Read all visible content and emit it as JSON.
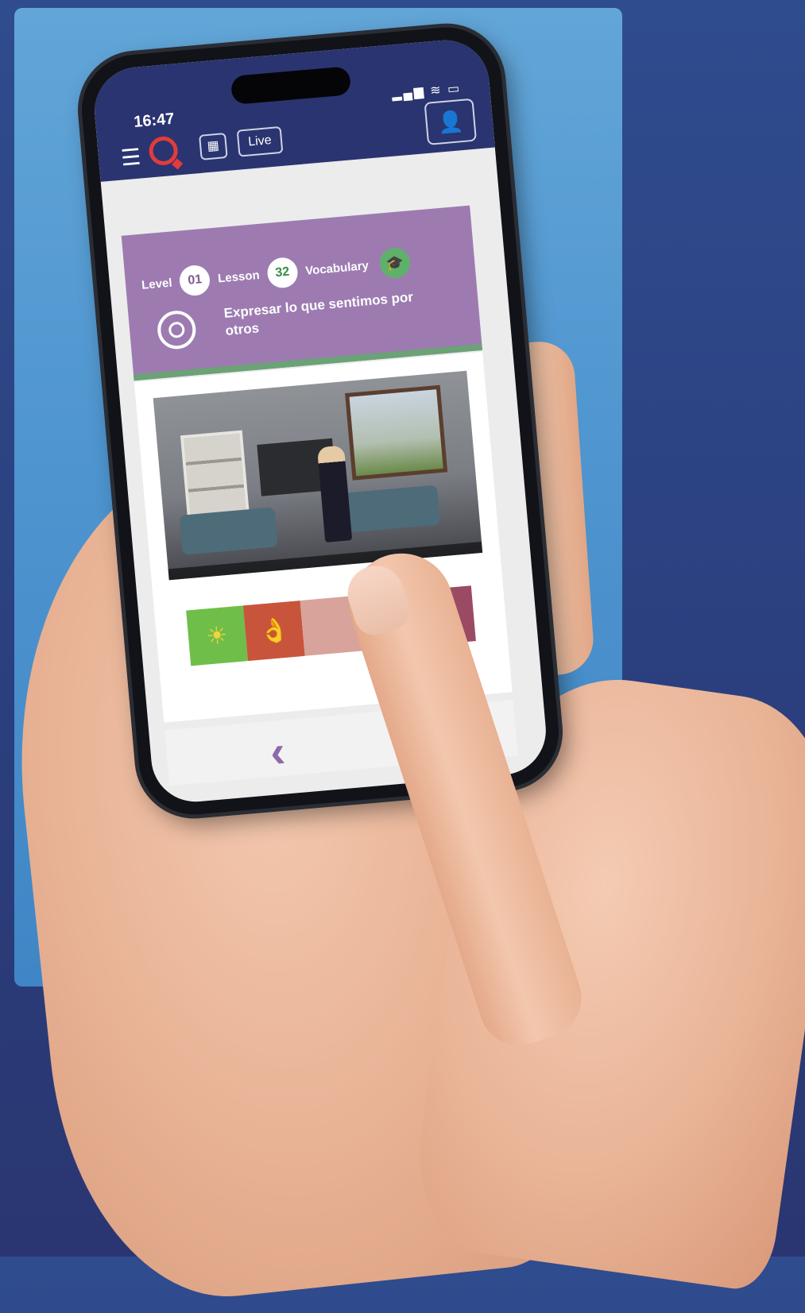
{
  "status_bar": {
    "time": "16:47",
    "icons": "▂▄▆ ≋ ▭"
  },
  "header": {
    "menu_icon": "☰",
    "grid_icon": "▦",
    "live_label": "Live",
    "profile_icon": "👤"
  },
  "lesson_card": {
    "level_label": "Level",
    "level_value": "01",
    "lesson_label": "Lesson",
    "lesson_value": "32",
    "type_label": "Vocabulary",
    "type_icon": "🎓",
    "goal": "Expresar lo que sentimos por otros"
  },
  "thumbnails": [
    {
      "icon": "☀"
    },
    {
      "icon": "👌"
    },
    {
      "icon": ""
    },
    {
      "icon": "●"
    },
    {
      "icon": "🦓"
    }
  ],
  "navigation": {
    "back_icon": "‹"
  },
  "colors": {
    "header_bg": "#2a3470",
    "card_bg": "#9d7bb1",
    "accent_green": "#6ba276",
    "accent_purple": "#8e6aa8"
  }
}
